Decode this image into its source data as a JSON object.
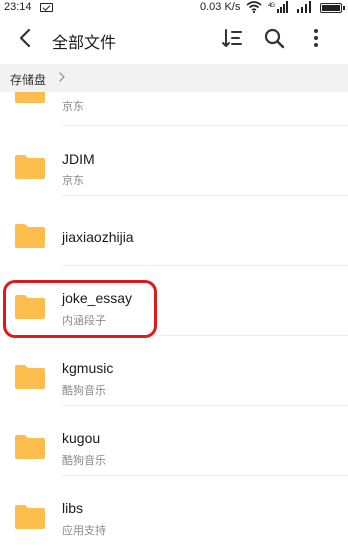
{
  "status_bar": {
    "time": "23:14",
    "speed": "0.03 K/s",
    "wifi": "wifi",
    "signal1": "4G .ıll",
    "signal2": ".ıll"
  },
  "toolbar": {
    "title": "全部文件"
  },
  "breadcrumb": {
    "root": "存储盘"
  },
  "folder_color": "#FDBE4E",
  "highlight_color": "#E0191B",
  "files": [
    {
      "name": "",
      "subtitle": "京东"
    },
    {
      "name": "JDIM",
      "subtitle": "京东"
    },
    {
      "name": "jiaxiaozhijia",
      "subtitle": ""
    },
    {
      "name": "joke_essay",
      "subtitle": "内涵段子"
    },
    {
      "name": "kgmusic",
      "subtitle": "酷狗音乐"
    },
    {
      "name": "kugou",
      "subtitle": "酷狗音乐"
    },
    {
      "name": "libs",
      "subtitle": "应用支持"
    }
  ]
}
